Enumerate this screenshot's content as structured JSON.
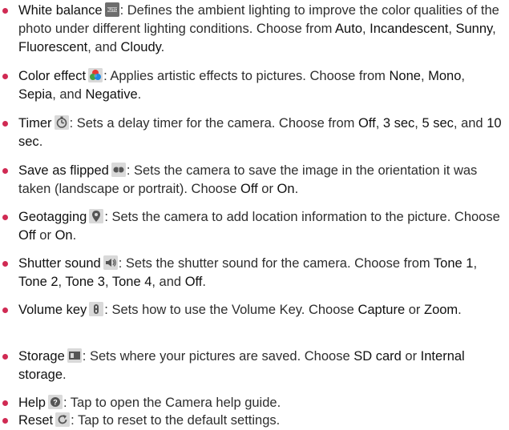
{
  "items": [
    {
      "name": "White balance",
      "icon": "white-balance-icon",
      "desc": ": Defines the ambient lighting to improve the color qualities of the photo under different lighting conditions. Choose from ",
      "opts": [
        "Auto",
        "Incandescent",
        "Sunny",
        "Fluorescent",
        "Cloudy"
      ],
      "seps": [
        ", ",
        ", ",
        ", ",
        ", and ",
        "."
      ]
    },
    {
      "name": "Color effect",
      "icon": "color-effect-icon",
      "desc": ": Applies artistic effects to pictures. Choose from ",
      "opts": [
        "None",
        "Mono",
        "Sepia",
        "Negative"
      ],
      "seps": [
        ", ",
        ", ",
        ", and ",
        "."
      ]
    },
    {
      "name": "Timer",
      "icon": "timer-icon",
      "desc": ": Sets a delay timer for the camera. Choose from ",
      "opts": [
        "Off",
        "3 sec",
        "5 sec",
        "10 sec"
      ],
      "seps": [
        ", ",
        ", ",
        ", and ",
        "."
      ]
    },
    {
      "name": "Save as flipped",
      "icon": "flip-icon",
      "desc": ": Sets the camera to save the image in the orientation it was taken (landscape or portrait). Choose ",
      "opts": [
        "Off",
        "On"
      ],
      "seps": [
        " or ",
        "."
      ]
    },
    {
      "name": "Geotagging",
      "icon": "geotag-icon",
      "desc": ": Sets the camera to add location information to the picture. Choose ",
      "opts": [
        "Off",
        "On"
      ],
      "seps": [
        " or ",
        "."
      ]
    },
    {
      "name": "Shutter sound",
      "icon": "shutter-sound-icon",
      "desc": ": Sets the shutter sound for the camera. Choose from ",
      "opts": [
        "Tone 1",
        "Tone 2",
        "Tone 3",
        "Tone 4",
        "Off"
      ],
      "seps": [
        ", ",
        ", ",
        ", ",
        ", and ",
        "."
      ]
    },
    {
      "name": "Volume key",
      "icon": "volume-key-icon",
      "desc": ": Sets how to use the Volume Key. Choose ",
      "opts": [
        "Capture",
        "Zoom"
      ],
      "seps": [
        " or ",
        "."
      ]
    },
    {
      "name": "Storage",
      "icon": "storage-icon",
      "desc": ": Sets where your pictures are saved. Choose ",
      "opts": [
        "SD card",
        "Internal storage"
      ],
      "seps": [
        " or ",
        "."
      ]
    },
    {
      "name": "Help",
      "icon": "help-icon",
      "desc": ": Tap to open the Camera help guide.",
      "opts": [],
      "seps": []
    },
    {
      "name": "Reset",
      "icon": "reset-icon",
      "desc": ": Tap to reset to the default settings.",
      "opts": [],
      "seps": []
    }
  ],
  "colors": {
    "bullet": "#d02a53",
    "body_text": "#2e2e2e",
    "emphasis_text": "#111111"
  }
}
